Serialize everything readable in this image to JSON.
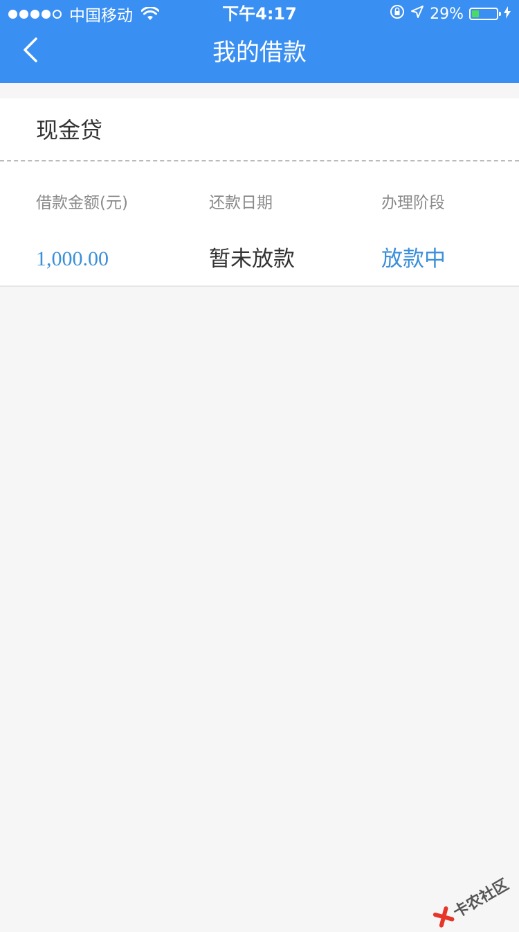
{
  "status_bar": {
    "carrier": "中国移动",
    "time": "下午4:17",
    "battery_percent": "29%",
    "battery_level": 0.29,
    "signal_bars_filled": 4,
    "signal_bars_total": 5
  },
  "nav": {
    "title": "我的借款",
    "back_icon": "chevron-left-icon"
  },
  "loan_card": {
    "title": "现金贷",
    "columns": [
      {
        "label": "借款金额(元)",
        "value": "1,000.00"
      },
      {
        "label": "还款日期",
        "value": "暂未放款"
      },
      {
        "label": "办理阶段",
        "value": "放款中"
      }
    ]
  },
  "watermark": {
    "text": "卡农社区"
  },
  "colors": {
    "header_bg": "#3a8ff3",
    "page_bg": "#f6f6f6",
    "accent_blue": "#3a8fd9",
    "battery_green": "#4cd964"
  }
}
